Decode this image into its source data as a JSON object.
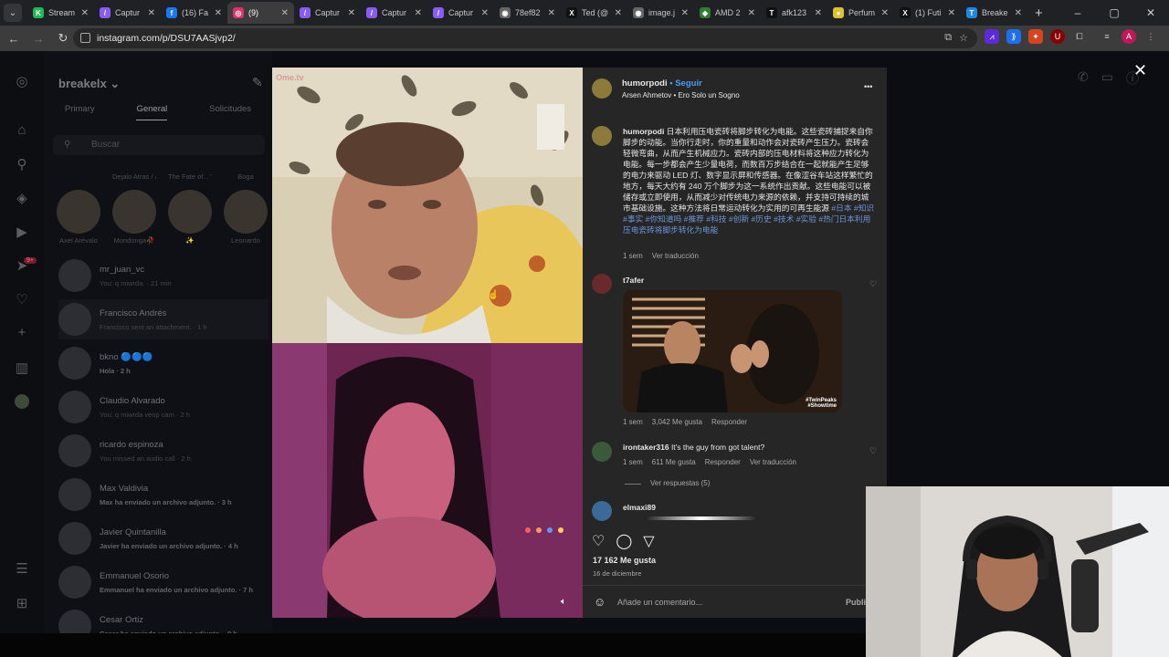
{
  "browser": {
    "tabs": [
      {
        "label": "Stream",
        "favicon_color": "#1db954",
        "favicon_glyph": "K",
        "active": false
      },
      {
        "label": "Captur",
        "favicon_color": "#8a5cf6",
        "favicon_glyph": "/",
        "active": false
      },
      {
        "label": "(16) Fa",
        "favicon_color": "#1877f2",
        "favicon_glyph": "f",
        "active": false
      },
      {
        "label": "(9)",
        "favicon_color": "#e1306c",
        "favicon_glyph": "◎",
        "active": true
      },
      {
        "label": "Captur",
        "favicon_color": "#8a5cf6",
        "favicon_glyph": "/",
        "active": false
      },
      {
        "label": "Captur",
        "favicon_color": "#8a5cf6",
        "favicon_glyph": "/",
        "active": false
      },
      {
        "label": "Captur",
        "favicon_color": "#8a5cf6",
        "favicon_glyph": "/",
        "active": false
      },
      {
        "label": "78ef82",
        "favicon_color": "#666",
        "favicon_glyph": "◉",
        "active": false
      },
      {
        "label": "Ted (@",
        "favicon_color": "#111",
        "favicon_glyph": "X",
        "active": false
      },
      {
        "label": "image.j",
        "favicon_color": "#666",
        "favicon_glyph": "◉",
        "active": false
      },
      {
        "label": "AMD 2",
        "favicon_color": "#2e7d32",
        "favicon_glyph": "◆",
        "active": false
      },
      {
        "label": "afk123",
        "favicon_color": "#111",
        "favicon_glyph": "T",
        "active": false
      },
      {
        "label": "Perfum",
        "favicon_color": "#e0c030",
        "favicon_glyph": "●",
        "active": false
      },
      {
        "label": "(1) Futi",
        "favicon_color": "#111",
        "favicon_glyph": "X",
        "active": false
      },
      {
        "label": "Breake",
        "favicon_color": "#1e88e5",
        "favicon_glyph": "T",
        "active": false
      }
    ],
    "new_tab": "+",
    "window_controls": [
      "–",
      "▢",
      "✕"
    ],
    "url": "instagram.com/p/DSU7AASjvp2/",
    "profile_initial": "A"
  },
  "instagram": {
    "dm": {
      "username": "breakelx",
      "tabs": [
        "Primary",
        "General",
        "Solicitudes"
      ],
      "search_placeholder": "Buscar",
      "notes": [
        {
          "note": "",
          "name": "Axel Arévalo"
        },
        {
          "note": "Dejalo Atras / Álvarez",
          "name": "Mondonga🥀"
        },
        {
          "note": "The Fate of... Taylor Swift · No la supero :(",
          "name": "✨"
        },
        {
          "note": "Boga",
          "name": "Leonardo"
        }
      ],
      "conversations": [
        {
          "name": "mr_juan_vc",
          "sub": "You: q miwrda. · 21 min",
          "bold": false
        },
        {
          "name": "Francisco Andrés",
          "sub": "Francisco sent an attachment. · 1 h",
          "bold": false
        },
        {
          "name": "bkno 🔵🔵🔵",
          "sub": "Hola · 2 h",
          "bold": true
        },
        {
          "name": "Claudio Alvarado",
          "sub": "You: q miwrda veop cam · 2 h",
          "bold": false
        },
        {
          "name": "ricardo espinoza",
          "sub": "You missed an audio call · 2 h",
          "bold": false
        },
        {
          "name": "Max Valdivia",
          "sub": "Max ha enviado un archivo adjunto. · 3 h",
          "bold": true
        },
        {
          "name": "Javier Quintanilla",
          "sub": "Javier ha enviado un archivo adjunto. · 4 h",
          "bold": true
        },
        {
          "name": "Emmanuel Osorio",
          "sub": "Emmanuel ha enviado un archivo adjunto. · 7 h",
          "bold": true
        },
        {
          "name": "Cesar Ortiz",
          "sub": "Cesar ha enviado un archivo adjunto. · 9 h",
          "bold": true
        }
      ],
      "notification_badge": "9+"
    },
    "post": {
      "watermark": "Ome.tv",
      "author": "humorpodi",
      "follow_label": "Seguir",
      "audio": "Arsen Ahmetov • Ero Solo un Sogno",
      "more": "•••",
      "caption_user": "humorpodi",
      "caption_text": "日本利用压电瓷砖将脚步转化为电能。这些瓷砖捕捉来自你脚步的动能。当你行走时，你的重量和动作会对瓷砖产生压力。瓷砖会轻微弯曲，从而产生机械应力。瓷砖内部的压电材料将这种应力转化为电能。每一步都会产生少量电荷，而数百万步结合在一起就能产生足够的电力来驱动 LED 灯、数字显示屏和传感器。在像涩谷车站这样繁忙的地方，每天大约有 240 万个脚步为这一系统作出贡献。这些电能可以被储存或立即使用，从而减少对传统电力来源的依赖，并支持可持续的城市基础设施。这种方法将日常运动转化为实用的可再生能源",
      "caption_tags": "#日本 #知识 #事实 #你知道吗 #推荐 #科技 #创新 #历史 #技术 #实验 #热门日本利用压电瓷砖将脚步转化为电能",
      "caption_meta": {
        "time": "1 sem",
        "translate": "Ver traducción"
      },
      "comments": [
        {
          "user": "t7afer",
          "text": "",
          "gif_tag": "#TwinPeaks\n#Showtime",
          "meta": {
            "time": "1 sem",
            "likes": "3,042 Me gusta",
            "reply": "Responder"
          }
        },
        {
          "user": "irontaker316",
          "text": "It's the guy from got talent?",
          "meta": {
            "time": "1 sem",
            "likes": "611 Me gusta",
            "reply": "Responder",
            "translate": "Ver traducción"
          },
          "replies": "Ver respuestas (5)"
        },
        {
          "user": "elmaxi89",
          "text": ""
        }
      ],
      "likes": "17 162 Me gusta",
      "date": "16 de diciembre",
      "comment_placeholder": "Añade un comentario...",
      "publish_label": "Publi"
    }
  },
  "colors": {
    "ig_blue_link": "#6f95d8",
    "follow_blue": "#4a9cf5",
    "dialog_bg": "#262626"
  }
}
